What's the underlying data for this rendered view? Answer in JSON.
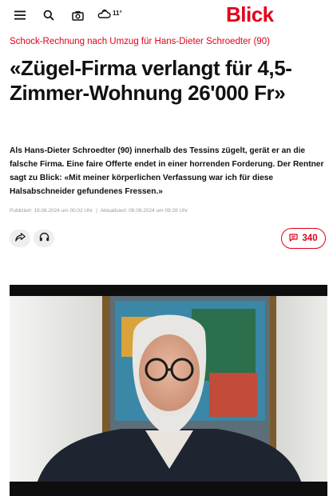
{
  "header": {
    "logo": "Blick",
    "weather_temp": "11°",
    "icons": [
      "menu-icon",
      "search-icon",
      "camera-icon",
      "weather-cloud-icon"
    ],
    "brand_color": "#e2001a"
  },
  "article": {
    "kicker": "Schock-Rechnung nach Umzug für Hans-Dieter Schroedter (90)",
    "headline": "«Zügel-Firma verlangt für 4,5-Zimmer-Wohnung 26'000 Fr»",
    "lead": "Als Hans-Dieter Schroedter (90) innerhalb des Tessins zügelt, gerät er an die falsche Firma. Eine faire Offerte endet in einer horrenden Forderung. Der Rentner sagt zu Blick: «Mit meiner körperlichen Verfassung war ich für diese Halsabschneider gefundenes Fressen.»",
    "published": "Publiziert: 19.08.2024 um 00:02 Uhr",
    "updated": "Aktualisiert: 08.08.2024 um 09:28 Uhr"
  },
  "actions": {
    "icons": [
      "share-icon",
      "headphones-icon",
      "comment-icon"
    ],
    "comment_count": "340"
  },
  "media": {
    "icons": [
      "article-photo"
    ]
  }
}
